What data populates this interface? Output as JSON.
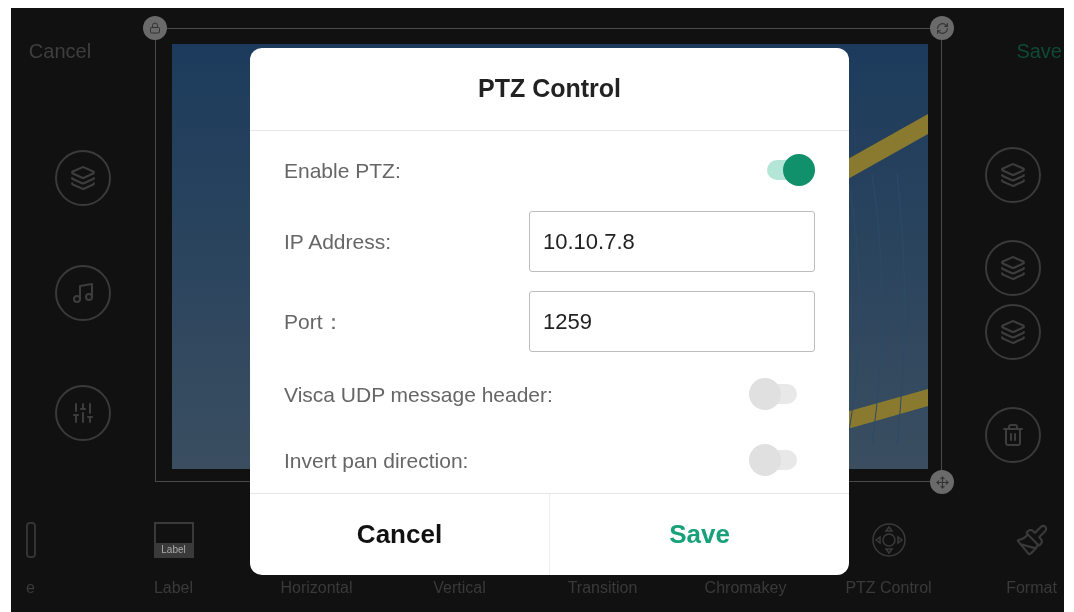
{
  "top_bar": {
    "cancel": "Cancel",
    "save": "Save"
  },
  "bottom_toolbar": [
    {
      "label": "e",
      "kind": "frame"
    },
    {
      "label": "Label",
      "kind": "label",
      "icon_text": "Label"
    },
    {
      "label": "Horizontal",
      "kind": "none"
    },
    {
      "label": "Vertical",
      "kind": "none"
    },
    {
      "label": "Transition",
      "kind": "none"
    },
    {
      "label": "Chromakey",
      "kind": "none"
    },
    {
      "label": "PTZ Control",
      "kind": "ptz"
    },
    {
      "label": "Format",
      "kind": "format"
    }
  ],
  "dialog": {
    "title": "PTZ Control",
    "rows": [
      {
        "kind": "switch",
        "label": "Enable PTZ:",
        "on": true
      },
      {
        "kind": "input",
        "label": "IP Address:",
        "value": "10.10.7.8"
      },
      {
        "kind": "input",
        "label": "Port：",
        "value": "1259"
      },
      {
        "kind": "switch",
        "label": "Visca UDP message header:",
        "on": false
      },
      {
        "kind": "switch",
        "label": "Invert pan direction:",
        "on": false
      }
    ],
    "buttons": [
      {
        "label": "Cancel",
        "kind": "cancel"
      },
      {
        "label": "Save",
        "kind": "save"
      }
    ]
  }
}
